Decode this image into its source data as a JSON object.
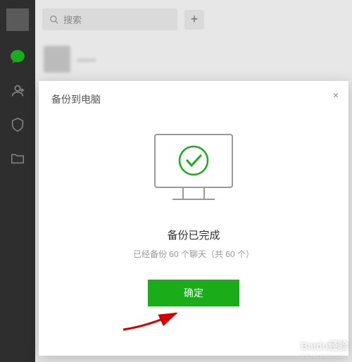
{
  "sidebar": {
    "icons": [
      "chat-icon",
      "contacts-icon",
      "collection-icon",
      "files-icon"
    ]
  },
  "search": {
    "placeholder": "搜索"
  },
  "chat_items": [
    {
      "name": "——"
    },
    {
      "name": "——"
    }
  ],
  "modal": {
    "title": "备份到电脑",
    "status_title": "备份已完成",
    "status_sub": "已经备份 60 个聊天（共 60 个）",
    "confirm_label": "确定"
  },
  "watermark": {
    "main": "Baidu经验",
    "sub": "jingyan.baidu.com"
  }
}
